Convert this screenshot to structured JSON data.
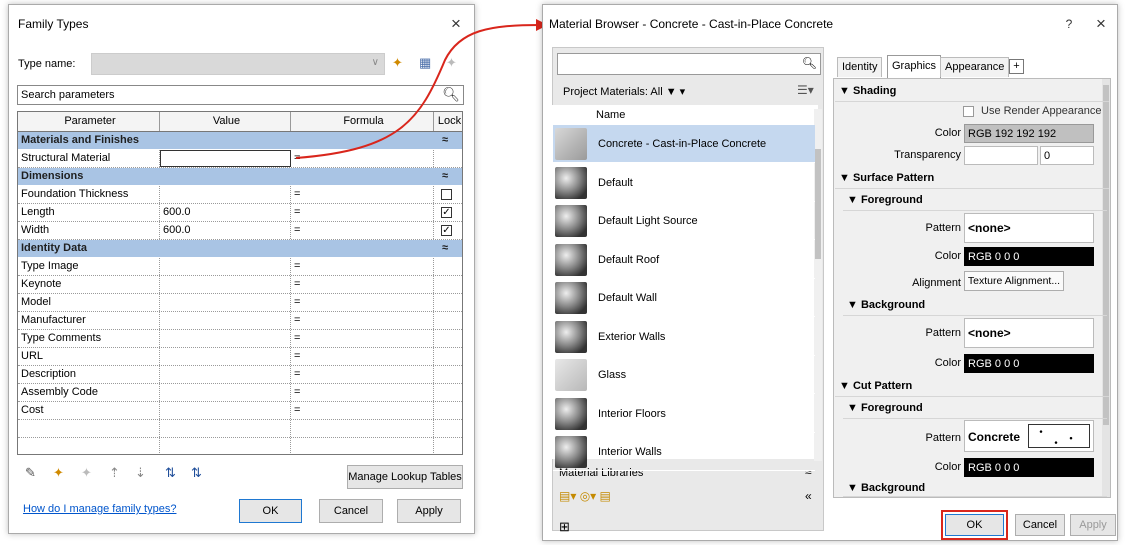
{
  "family_types": {
    "title": "Family Types",
    "close": "×",
    "type_name_label": "Type name:",
    "search_placeholder": "Search parameters",
    "columns": [
      "Parameter",
      "Value",
      "Formula",
      "Lock"
    ],
    "groups": [
      {
        "name": "Materials and Finishes",
        "rows": [
          {
            "param": "Structural Material",
            "value": "",
            "formula": "=",
            "lock": null
          }
        ]
      },
      {
        "name": "Dimensions",
        "rows": [
          {
            "param": "Foundation Thickness",
            "value": "",
            "formula": "=",
            "lock": false
          },
          {
            "param": "Length",
            "value": "600.0",
            "formula": "=",
            "lock": true
          },
          {
            "param": "Width",
            "value": "600.0",
            "formula": "=",
            "lock": true
          }
        ]
      },
      {
        "name": "Identity Data",
        "rows": [
          {
            "param": "Type Image",
            "value": "",
            "formula": "=",
            "lock": null
          },
          {
            "param": "Keynote",
            "value": "",
            "formula": "=",
            "lock": null
          },
          {
            "param": "Model",
            "value": "",
            "formula": "=",
            "lock": null
          },
          {
            "param": "Manufacturer",
            "value": "",
            "formula": "=",
            "lock": null
          },
          {
            "param": "Type Comments",
            "value": "",
            "formula": "=",
            "lock": null
          },
          {
            "param": "URL",
            "value": "",
            "formula": "=",
            "lock": null
          },
          {
            "param": "Description",
            "value": "",
            "formula": "=",
            "lock": null
          },
          {
            "param": "Assembly Code",
            "value": "",
            "formula": "=",
            "lock": null
          },
          {
            "param": "Cost",
            "value": "",
            "formula": "=",
            "lock": null
          }
        ]
      }
    ],
    "manage_lookup": "Manage Lookup Tables",
    "help_link": "How do I manage family types?",
    "ok": "OK",
    "cancel": "Cancel",
    "apply": "Apply"
  },
  "material_browser": {
    "title": "Material Browser - Concrete - Cast-in-Place Concrete",
    "help": "?",
    "close": "×",
    "filter_label": "Project Materials: All",
    "name_header": "Name",
    "materials": [
      "Concrete - Cast-in-Place Concrete",
      "Default",
      "Default Light Source",
      "Default Roof",
      "Default Wall",
      "Exterior Walls",
      "Glass",
      "Interior Floors",
      "Interior Walls"
    ],
    "libraries_label": "Material Libraries",
    "tabs": [
      "Identity",
      "Graphics",
      "Appearance",
      "+"
    ],
    "shading": {
      "header": "Shading",
      "use_render": "Use Render Appearance",
      "color_label": "Color",
      "color_value": "RGB 192 192 192",
      "transparency_label": "Transparency",
      "transparency_value": "0"
    },
    "surface_pattern": {
      "header": "Surface Pattern",
      "foreground": "Foreground",
      "pattern_label": "Pattern",
      "pattern_value": "<none>",
      "color_label": "Color",
      "color_value": "RGB 0 0 0",
      "alignment_label": "Alignment",
      "alignment_value": "Texture Alignment...",
      "background": "Background",
      "bg_pattern_value": "<none>",
      "bg_color_value": "RGB 0 0 0"
    },
    "cut_pattern": {
      "header": "Cut Pattern",
      "foreground": "Foreground",
      "pattern_label": "Pattern",
      "pattern_value": "Concrete",
      "color_label": "Color",
      "color_value": "RGB 0 0 0",
      "background": "Background"
    },
    "ok": "OK",
    "cancel": "Cancel",
    "apply": "Apply"
  },
  "colors": {
    "section": "#a9c4e4",
    "selected": "#c5d8ef",
    "arrow": "#d9261c"
  }
}
